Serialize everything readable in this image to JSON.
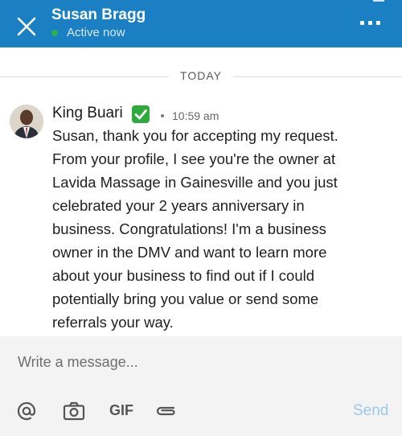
{
  "header": {
    "contact_name": "Susan Bragg",
    "status": "Active now",
    "accent_color": "#1b7fc4",
    "close_icon": "close-icon",
    "more_icon": "more-options-icon"
  },
  "conversation": {
    "day_label": "TODAY",
    "message": {
      "sender": "King Buari",
      "verified_icon": "check-mark-button-icon",
      "time": "10:59 am",
      "lines": [
        "Susan, thank you for accepting my request.",
        "From your profile, I see you're the owner at",
        "Lavida Massage in Gainesville and you just",
        "celebrated your 2 years anniversary in",
        "business. Congratulations! I'm a business",
        "owner in the DMV and want to learn more",
        "about your business to find out if I could",
        "potentially bring you value or send some",
        "referrals your way."
      ]
    }
  },
  "composer": {
    "placeholder": "Write a message...",
    "tools": [
      "mention-icon",
      "camera-icon",
      "gif-icon",
      "attachment-icon"
    ],
    "gif_label": "GIF",
    "send_label": "Send"
  }
}
